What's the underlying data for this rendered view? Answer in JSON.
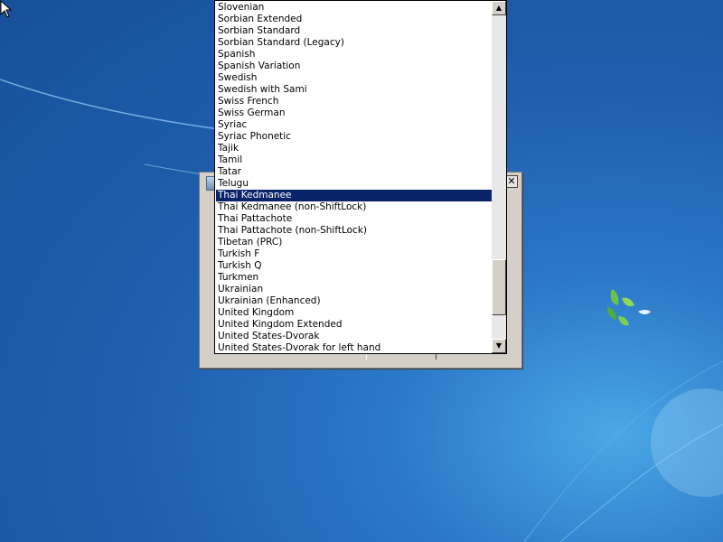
{
  "desktop": {
    "logo_icon": "windows-flag-logo-icon",
    "cursor_icon": "arrow-cursor-icon"
  },
  "dialog": {
    "close_label": "✕",
    "icon": "setup-icon"
  },
  "dropdown": {
    "selected_index": 16,
    "selected_color": "#0a246a",
    "items": [
      "Slovenian",
      "Sorbian Extended",
      "Sorbian Standard",
      "Sorbian Standard (Legacy)",
      "Spanish",
      "Spanish Variation",
      "Swedish",
      "Swedish with Sami",
      "Swiss French",
      "Swiss German",
      "Syriac",
      "Syriac Phonetic",
      "Tajik",
      "Tamil",
      "Tatar",
      "Telugu",
      "Thai Kedmanee",
      "Thai Kedmanee (non-ShiftLock)",
      "Thai Pattachote",
      "Thai Pattachote (non-ShiftLock)",
      "Tibetan (PRC)",
      "Turkish F",
      "Turkish Q",
      "Turkmen",
      "Ukrainian",
      "Ukrainian (Enhanced)",
      "United Kingdom",
      "United Kingdom Extended",
      "United States-Dvorak",
      "United States-Dvorak for left hand"
    ],
    "scroll_up_glyph": "▲",
    "scroll_down_glyph": "▼"
  }
}
